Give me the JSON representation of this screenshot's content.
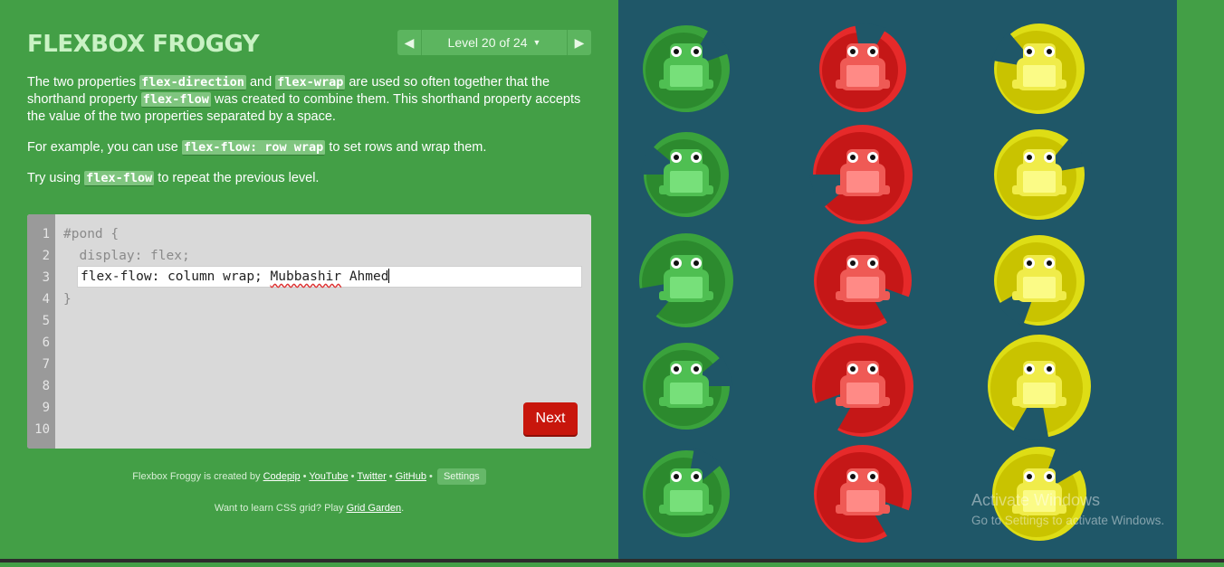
{
  "title": "FLEXBOX FROGGY",
  "level": {
    "label": "Level 20 of 24",
    "prev_icon": "chevron-left-icon",
    "next_icon": "chevron-right-icon",
    "dropdown_icon": "caret-down-icon"
  },
  "instructions": {
    "p1": {
      "t1": "The two properties ",
      "c1": "flex-direction",
      "t2": " and ",
      "c2": "flex-wrap",
      "t3": " are used so often together that the shorthand property ",
      "c3": "flex-flow",
      "t4": " was created to combine them. This shorthand property accepts the value of the two properties separated by a space."
    },
    "p2": {
      "t1": "For example, you can use ",
      "c1": "flex-flow: row wrap",
      "t2": " to set rows and wrap them."
    },
    "p3": {
      "t1": "Try using ",
      "c1": "flex-flow",
      "t2": " to repeat the previous level."
    }
  },
  "editor": {
    "line_numbers": [
      "1",
      "2",
      "3",
      "4",
      "5",
      "6",
      "7",
      "8",
      "9",
      "10"
    ],
    "line1": "#pond {",
    "line2": "  display: flex;",
    "input_value_a": "flex-flow: column wrap; ",
    "input_value_b": "Mubbashir",
    "input_value_c": " Ahmed",
    "line4": "}",
    "next_label": "Next"
  },
  "footer": {
    "line1_prefix": "Flexbox Froggy is created by ",
    "codepip": "Codepip",
    "sep": " • ",
    "youtube": "YouTube",
    "twitter": "Twitter",
    "github": "GitHub",
    "settings": "Settings",
    "line2_prefix": "Want to learn CSS grid? Play ",
    "gridgarden": "Grid Garden",
    "line2_suffix": "."
  },
  "pond": {
    "columns": [
      {
        "color": "green",
        "frogs": 5
      },
      {
        "color": "red",
        "frogs": 5
      },
      {
        "color": "yellow",
        "frogs": 5
      }
    ],
    "colors": {
      "green": {
        "pad": "#2c8a2e",
        "pad_light": "#3aa23c",
        "frog": "#77e07a",
        "frog_dark": "#4fbf52"
      },
      "red": {
        "pad": "#c51717",
        "pad_light": "#e62a2a",
        "frog": "#ff8a86",
        "frog_dark": "#ef5a55"
      },
      "yellow": {
        "pad": "#c9c300",
        "pad_light": "#dedd15",
        "frog": "#fbfb86",
        "frog_dark": "#f0ec4a"
      }
    }
  },
  "watermark": {
    "line1": "Activate Windows",
    "line2": "Go to Settings to activate Windows."
  }
}
